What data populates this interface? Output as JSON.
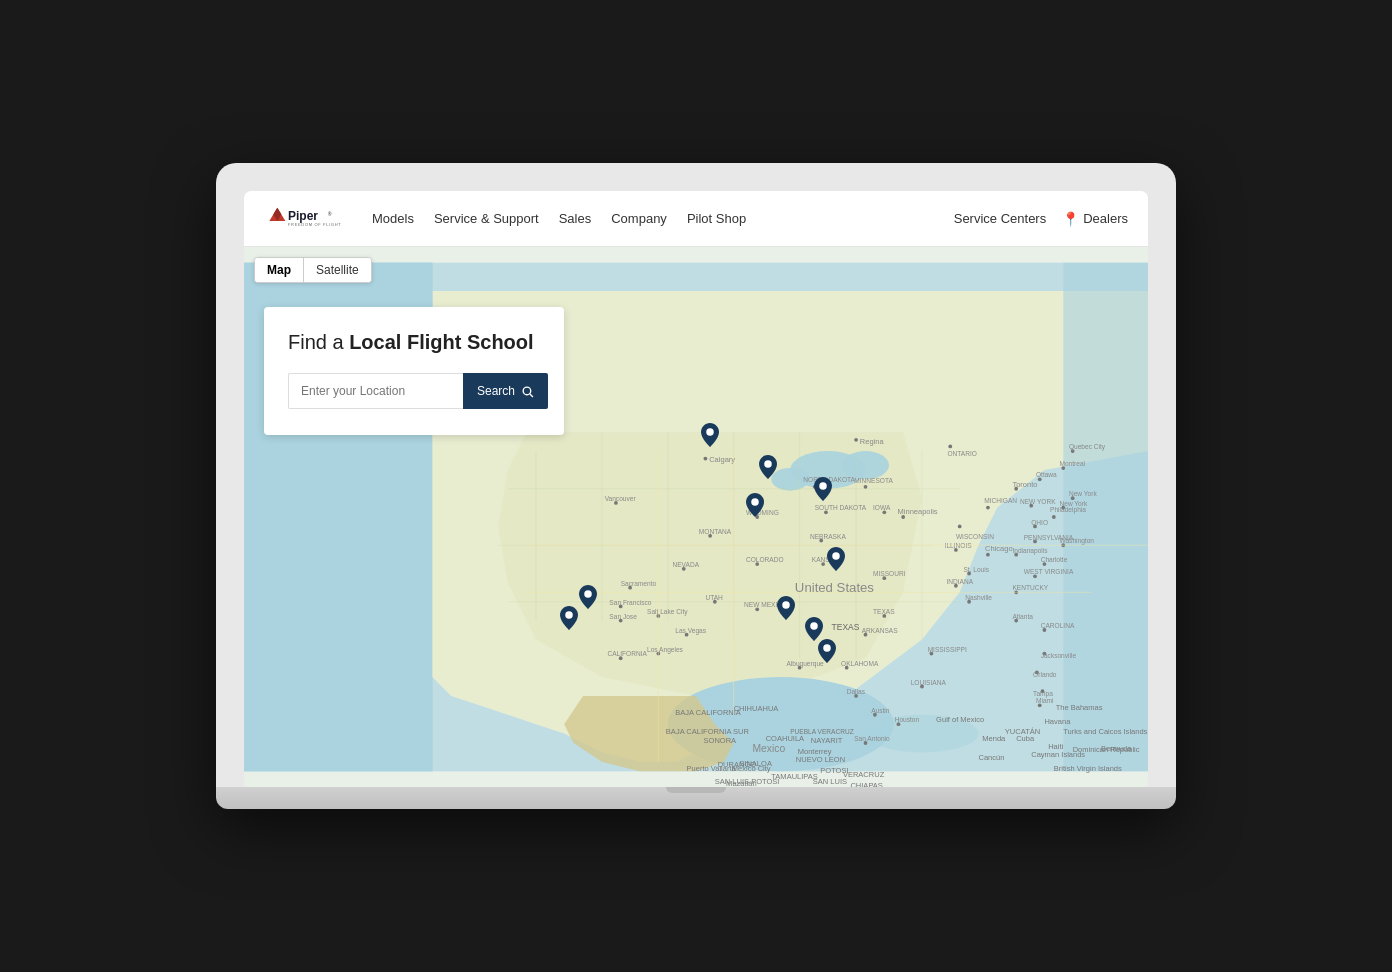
{
  "header": {
    "logo_alt": "Piper - Freedom of Flight",
    "nav": {
      "items": [
        {
          "label": "Models",
          "id": "models"
        },
        {
          "label": "Service & Support",
          "id": "service-support"
        },
        {
          "label": "Sales",
          "id": "sales"
        },
        {
          "label": "Company",
          "id": "company"
        },
        {
          "label": "Pilot Shop",
          "id": "pilot-shop"
        }
      ]
    },
    "right": {
      "service_centers": "Service Centers",
      "dealers": "Dealers"
    }
  },
  "map": {
    "tabs": [
      {
        "label": "Map",
        "active": true
      },
      {
        "label": "Satellite",
        "active": false
      }
    ],
    "search_overlay": {
      "title_part1": "Find a ",
      "title_bold": "Local Flight School",
      "input_placeholder": "Enter your Location",
      "button_label": "Search"
    },
    "pins": [
      {
        "id": "pin1",
        "left": "46",
        "top": "53"
      },
      {
        "id": "pin2",
        "left": "51.5",
        "top": "37"
      },
      {
        "id": "pin3",
        "left": "56.5",
        "top": "51"
      },
      {
        "id": "pin4",
        "left": "57.5",
        "top": "44"
      },
      {
        "id": "pin5",
        "left": "62",
        "top": "55"
      },
      {
        "id": "pin6",
        "left": "63.5",
        "top": "48"
      },
      {
        "id": "pin7",
        "left": "67",
        "top": "57"
      },
      {
        "id": "pin8",
        "left": "64.5",
        "top": "62"
      },
      {
        "id": "pin9",
        "left": "60.5",
        "top": "70"
      },
      {
        "id": "pin10",
        "left": "63.5",
        "top": "73"
      },
      {
        "id": "pin11",
        "left": "64.5",
        "top": "77"
      },
      {
        "id": "pin12",
        "left": "35.5",
        "top": "65"
      },
      {
        "id": "pin13",
        "left": "37.5",
        "top": "68"
      }
    ]
  }
}
